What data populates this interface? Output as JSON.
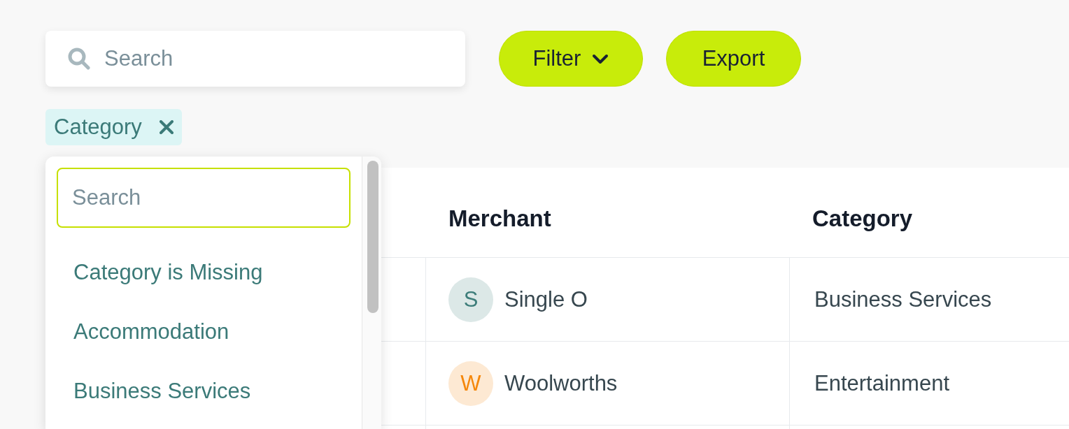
{
  "toolbar": {
    "search": {
      "placeholder": "Search"
    },
    "buttons": [
      {
        "label": "Filter",
        "kind": "dropdown"
      },
      {
        "label": "Export",
        "kind": "plain"
      }
    ]
  },
  "active_filters": [
    {
      "label": "Category"
    }
  ],
  "filter_dropdown": {
    "search": {
      "placeholder": "Search"
    },
    "options": [
      "Category is Missing",
      "Accommodation",
      "Business Services"
    ]
  },
  "table": {
    "columns": [
      "Merchant",
      "Category"
    ],
    "rows": [
      {
        "merchant": "Single O",
        "avatar": {
          "letter": "S",
          "color": "#3d7d7a"
        },
        "category": "Business Services"
      },
      {
        "merchant": "Woolworths",
        "avatar": {
          "letter": "W",
          "color": "#f5870a"
        },
        "category": "Entertainment"
      }
    ]
  }
}
